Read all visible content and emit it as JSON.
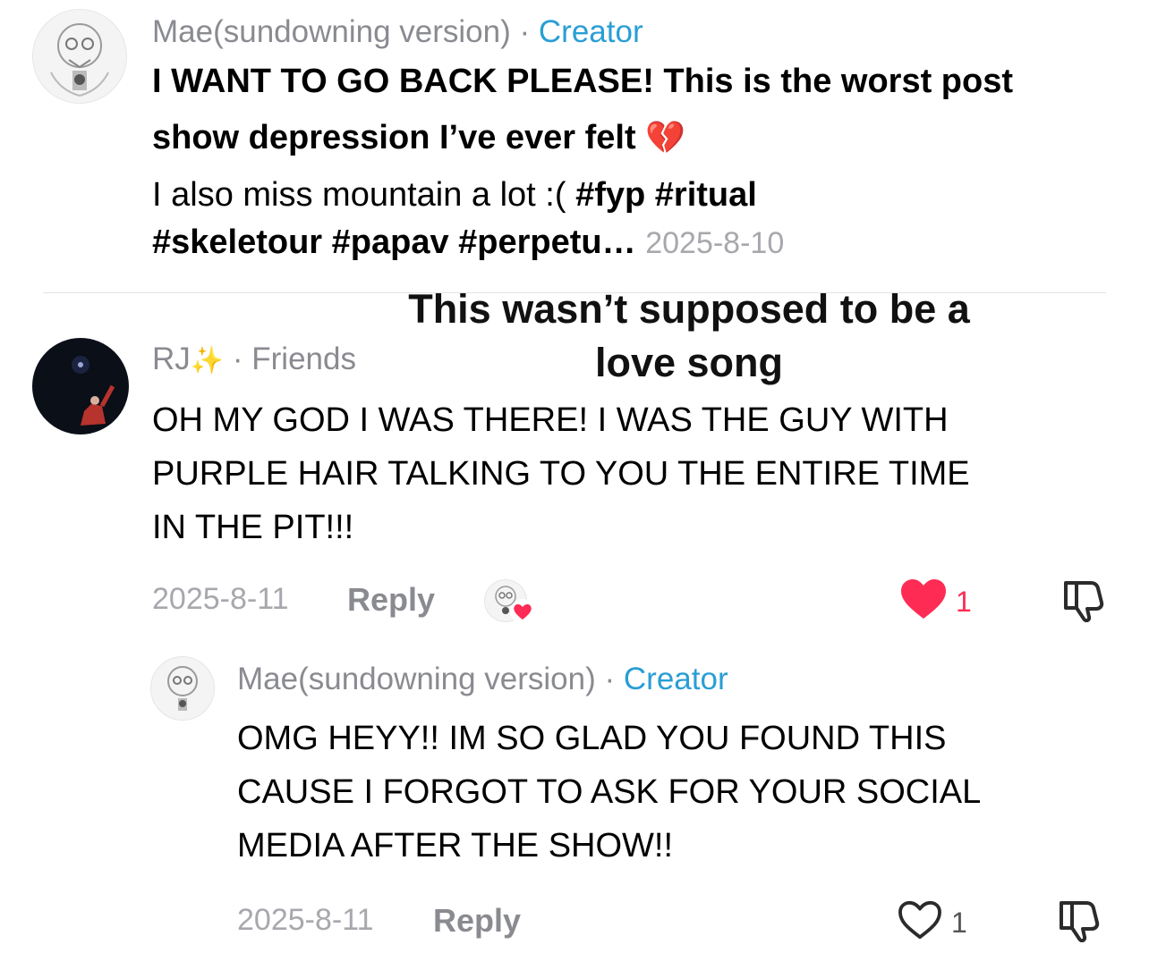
{
  "post": {
    "author": "Mae(sundowning version)",
    "separator": "·",
    "badge": "Creator",
    "caption_line1": "I WANT TO GO BACK PLEASE! This is the worst post",
    "caption_line2": "show depression I’ve ever felt",
    "caption_emoji": "💔",
    "caption_line3_text": "I also miss mountain a lot :( ",
    "caption_line3_tags": "#fyp #ritual",
    "caption_line4_tags": "#skeletour #papav #perpetu…",
    "date": "2025-8-10"
  },
  "overlay": {
    "line1": "This wasn’t supposed to be a",
    "line2": "love song"
  },
  "comment": {
    "author": "RJ",
    "author_emoji": "✨",
    "separator": "·",
    "relation": "Friends",
    "text_line1": "OH MY GOD I WAS THERE! I WAS THE GUY WITH",
    "text_line2": "PURPLE HAIR TALKING TO YOU THE ENTIRE TIME",
    "text_line3": "IN THE PIT!!!",
    "date": "2025-8-11",
    "reply_label": "Reply",
    "like_count": "1"
  },
  "reply": {
    "author": "Mae(sundowning version)",
    "separator": "·",
    "badge": "Creator",
    "text_line1": "OMG HEYY!! IM SO GLAD YOU FOUND THIS",
    "text_line2": "CAUSE I FORGOT TO ASK FOR YOUR SOCIAL",
    "text_line3": "MEDIA AFTER THE SHOW!!",
    "date": "2025-8-11",
    "reply_label": "Reply",
    "like_count": "1"
  },
  "colors": {
    "creator": "#2a9ed4",
    "like_red": "#fe2c55",
    "meta_gray": "#8a8b91"
  },
  "icons": {
    "liked": "heart-filled-icon",
    "like": "heart-outline-icon",
    "dislike": "thumbs-down-icon",
    "creator_liked": "creator-liked-badge"
  }
}
